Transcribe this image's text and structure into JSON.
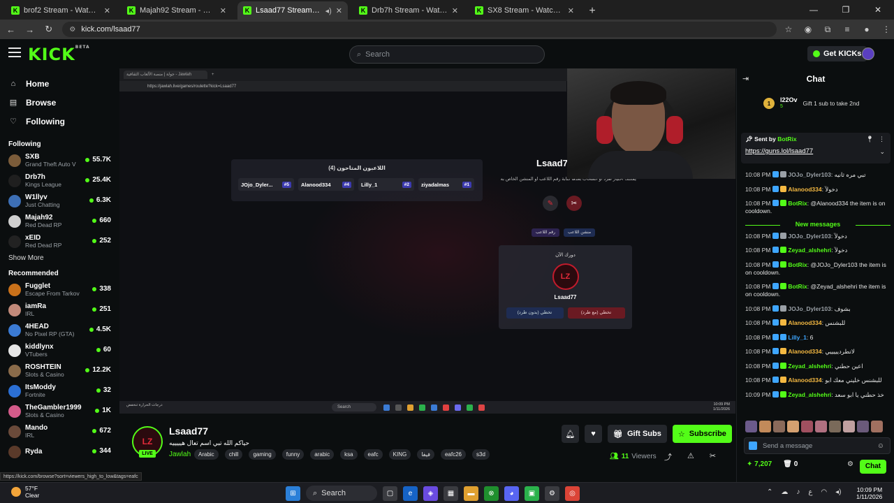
{
  "browser": {
    "tabs": [
      {
        "title": "brof2 Stream - Watch Live on K",
        "active": false
      },
      {
        "title": "Majah92 Stream - Watch Live o",
        "active": false
      },
      {
        "title": "Lsaad77 Stream - Watch Live",
        "active": true
      },
      {
        "title": "Drb7h Stream - Watch Live on K",
        "active": false
      },
      {
        "title": "SX8 Stream - Watch Live on Kic",
        "active": false
      }
    ],
    "url": "kick.com/lsaad77"
  },
  "header": {
    "logo": "KICK",
    "logo_badge": "BETA",
    "search_placeholder": "Search",
    "get_kicks": "Get KICKs"
  },
  "sidebar": {
    "nav": [
      {
        "label": "Home",
        "icon": "home-icon"
      },
      {
        "label": "Browse",
        "icon": "browse-icon"
      },
      {
        "label": "Following",
        "icon": "heart-icon"
      }
    ],
    "following_heading": "Following",
    "following": [
      {
        "name": "SXB",
        "category": "Grand Theft Auto V",
        "viewers": "55.7K",
        "color": "#7b5c3a"
      },
      {
        "name": "Drb7h",
        "category": "Kings League",
        "viewers": "25.4K",
        "color": "#1f1f1f"
      },
      {
        "name": "W1llyv",
        "category": "Just Chatting",
        "viewers": "6.3K",
        "color": "#3d6fb5"
      },
      {
        "name": "Majah92",
        "category": "Red Dead RP",
        "viewers": "660",
        "color": "#cfcfcf"
      },
      {
        "name": "xEID",
        "category": "Red Dead RP",
        "viewers": "252",
        "color": "#222"
      }
    ],
    "show_more": "Show More",
    "recommended_heading": "Recommended",
    "recommended": [
      {
        "name": "Fugglet",
        "category": "Escape From Tarkov",
        "viewers": "338",
        "color": "#c9711a"
      },
      {
        "name": "iamRa",
        "category": "IRL",
        "viewers": "251",
        "color": "#c28a7a"
      },
      {
        "name": "4HEAD",
        "category": "No Pixel RP (GTA)",
        "viewers": "4.5K",
        "color": "#3b7bd4"
      },
      {
        "name": "kiddlynx",
        "category": "VTubers",
        "viewers": "60",
        "color": "#e7e7e7"
      },
      {
        "name": "ROSHTEIN",
        "category": "Slots & Casino",
        "viewers": "12.2K",
        "color": "#8a6b4a"
      },
      {
        "name": "ItsModdy",
        "category": "Fortnite",
        "viewers": "32",
        "color": "#2b6fd4"
      },
      {
        "name": "TheGambler1999",
        "category": "Slots & Casino",
        "viewers": "1K",
        "color": "#d45b8a"
      },
      {
        "name": "Mando",
        "category": "IRL",
        "viewers": "672",
        "color": "#6a4a3a"
      },
      {
        "name": "Ryda",
        "category": "",
        "viewers": "344",
        "color": "#5a3a2a"
      }
    ]
  },
  "video": {
    "inner_tab": "جولة | منصة الألعاب الثقافية - Jawlah",
    "inner_url": "https://jawlah.live/games/roulette?kick=Lsaad77",
    "players_title": "اللاعبون المتاحون (4)",
    "players": [
      {
        "name": "JOjo_Dyler...",
        "num": "#5"
      },
      {
        "name": "Alanood334",
        "num": "#4"
      },
      {
        "name": "Lilly_1",
        "num": "#2"
      },
      {
        "name": "ziyadalmas",
        "num": "#1"
      }
    ],
    "streamer_label": "Lsaad7",
    "instructions": "يمكنك اختيار طرد أو انسحاب بعدها كتابة رقم اللاعب او المنشن الخاص به",
    "turn_label": "دورك الآن",
    "turn_player": "Lsaad77",
    "skip_no_kick": "تخطي (بدون طرد)",
    "skip_kick": "تخطي (مع طرد)",
    "taskbar_search": "Search",
    "taskbar_weather": "درجات الحرارة تنخفض",
    "taskbar_time": "10:09 PM",
    "taskbar_date": "1/11/2026"
  },
  "stream": {
    "name": "Lsaad77",
    "title": "حياكم الله تبي اسم تعال هيييييه",
    "category": "Jawlah",
    "tags": [
      "Arabic",
      "chill",
      "gaming",
      "funny",
      "arabic",
      "ksa",
      "eafc",
      "KING",
      "فيفا",
      "eafc26",
      "s3d"
    ],
    "live": "LIVE",
    "gift_subs": "Gift Subs",
    "subscribe": "Subscribe",
    "viewers_count": "11",
    "viewers_label": "Viewers",
    "status_url": "https://kick.com/browse?sort=viewers_high_to_low&tags=eafc"
  },
  "chat": {
    "title": "Chat",
    "gifter_rank": "1",
    "gifter_name": "l22Ov",
    "gifter_count": "5",
    "gift_prompt": "Gift 1 sub to take 2nd",
    "pinned_by": "Sent by",
    "pinned_user": "BotRix",
    "pinned_link": "https://guns.lol/lsaad77",
    "messages": [
      {
        "time": "10:08 PM",
        "user": "JOJo_Dyler103",
        "color": "#9aa0a6",
        "text": "تبي مره ثانيه"
      },
      {
        "time": "10:08 PM",
        "user": "Alanood334",
        "color": "#f5b942",
        "text": "دخولآ"
      },
      {
        "time": "10:08 PM",
        "user": "BotRix",
        "color": "#53fc18",
        "text": "@Alanood334 the item is on cooldown."
      }
    ],
    "new_messages": "New messages",
    "messages2": [
      {
        "time": "10:08 PM",
        "user": "JOJo_Dyler103",
        "color": "#9aa0a6",
        "text": "دخولآ"
      },
      {
        "time": "10:08 PM",
        "user": "Zeyad_alshehri",
        "color": "#53fc18",
        "text": "دخولآ"
      },
      {
        "time": "10:08 PM",
        "user": "BotRix",
        "color": "#53fc18",
        "text": "@JOJo_Dyler103 the item is on cooldown."
      },
      {
        "time": "10:08 PM",
        "user": "BotRix",
        "color": "#53fc18",
        "text": "@Zeyad_alshehri the item is on cooldown."
      },
      {
        "time": "10:08 PM",
        "user": "JOJo_Dyler103",
        "color": "#9aa0a6",
        "text": "بشوف"
      },
      {
        "time": "10:08 PM",
        "user": "Alanood334",
        "color": "#f5b942",
        "text": "للبشنس"
      },
      {
        "time": "10:08 PM",
        "user": "Lilly_1",
        "color": "#3ea6ff",
        "text": "6"
      },
      {
        "time": "10:08 PM",
        "user": "Alanood334",
        "color": "#f5b942",
        "text": "لاتطرديييييي"
      },
      {
        "time": "10:08 PM",
        "user": "Zeyad_alshehri",
        "color": "#53fc18",
        "text": "اعين حطني"
      },
      {
        "time": "10:08 PM",
        "user": "Alanood334",
        "color": "#f5b942",
        "text": "للبشنس خليني معك ابو"
      },
      {
        "time": "10:09 PM",
        "user": "Zeyad_alshehri",
        "color": "#53fc18",
        "text": "خذ حطني يا ابو سعد"
      }
    ],
    "input_placeholder": "Send a message",
    "points": "7,207",
    "mod_count": "0",
    "chat_button": "Chat"
  },
  "taskbar": {
    "temp": "57°F",
    "cond": "Clear",
    "search": "Search",
    "time": "10:09 PM",
    "date": "1/11/2026"
  }
}
